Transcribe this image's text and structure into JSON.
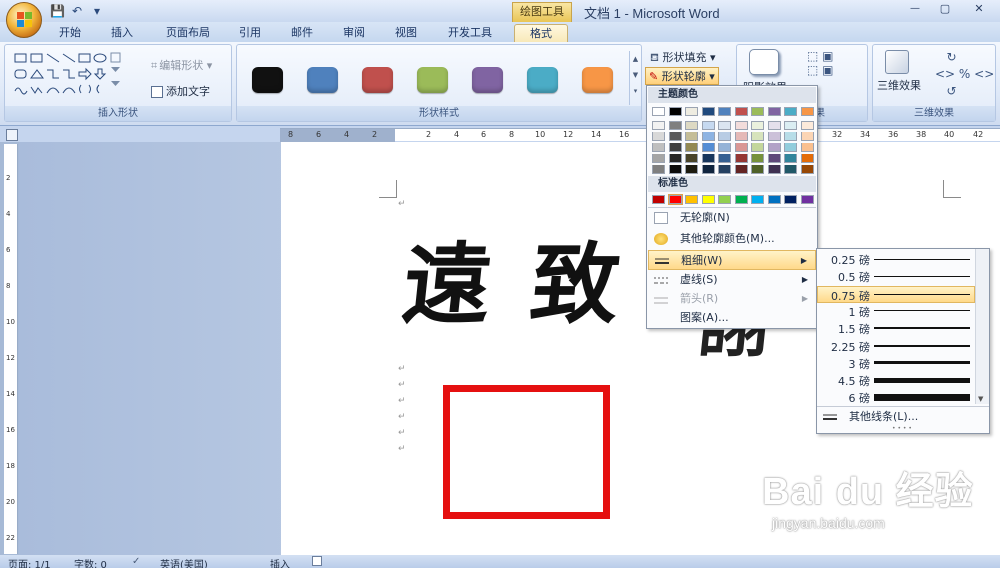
{
  "window": {
    "title": "文档 1 - Microsoft Word",
    "context_tool": "绘图工具",
    "qa_save": "💾",
    "qa_undo": "↶",
    "qa_dropdown": "▾",
    "win_min": "—",
    "win_max": "▢",
    "win_close": "✕"
  },
  "tabs": [
    "开始",
    "插入",
    "页面布局",
    "引用",
    "邮件",
    "审阅",
    "视图",
    "开发工具",
    "格式"
  ],
  "ribbon": {
    "insert_shapes_label": "插入形状",
    "edit_shape": "编辑形状",
    "add_text": "添加文字",
    "shape_styles_label": "形状样式",
    "shape_fill": "形状填充",
    "shape_outline": "形状轮廓",
    "shadow_effects": "阴影效果",
    "three_d_effects": "三维效果",
    "three_d_effects_label": "三维效果",
    "shadow_group_tail": "果",
    "style_swatches": [
      "#111111",
      "#4f81bd",
      "#c0504d",
      "#9bbb59",
      "#8064a2",
      "#4bacc6",
      "#f79646"
    ]
  },
  "ruler_ticks": [
    "8",
    "6",
    "4",
    "2",
    "2",
    "4",
    "6",
    "8",
    "10",
    "12",
    "14",
    "16",
    "32",
    "34",
    "36",
    "38",
    "40",
    "42"
  ],
  "vruler_ticks": [
    "2",
    "4",
    "6",
    "8",
    "10",
    "12",
    "14",
    "16",
    "18",
    "20",
    "22"
  ],
  "document": {
    "calligraphy_text": "遠致",
    "calligraphy_tail": "詡",
    "para_mark": "↵"
  },
  "status": {
    "page": "页面: 1/1",
    "words": "字数: 0",
    "language": "英语(美国)",
    "insert": "插入"
  },
  "menu": {
    "theme_colors_label": "主题颜色",
    "standard_colors_label": "标准色",
    "theme_top_row": [
      "#ffffff",
      "#000000",
      "#eeece1",
      "#1f497d",
      "#4f81bd",
      "#c0504d",
      "#9bbb59",
      "#8064a2",
      "#4bacc6",
      "#f79646"
    ],
    "theme_columns": [
      [
        "#f2f2f2",
        "#d8d8d8",
        "#bfbfbf",
        "#a5a5a5",
        "#7f7f7f"
      ],
      [
        "#7f7f7f",
        "#595959",
        "#3f3f3f",
        "#262626",
        "#0c0c0c"
      ],
      [
        "#ddd9c3",
        "#c4bd97",
        "#938953",
        "#494429",
        "#1d1b10"
      ],
      [
        "#c6d9f0",
        "#8db3e2",
        "#548dd4",
        "#17365d",
        "#0f243e"
      ],
      [
        "#dbe5f1",
        "#b8cce4",
        "#95b3d7",
        "#366092",
        "#244061"
      ],
      [
        "#f2dcdb",
        "#e5b9b7",
        "#d99694",
        "#953734",
        "#632423"
      ],
      [
        "#ebf1dd",
        "#d7e3bc",
        "#c3d69b",
        "#76923c",
        "#4f6128"
      ],
      [
        "#e5e0ec",
        "#ccc1d9",
        "#b2a2c7",
        "#5f497a",
        "#3f3151"
      ],
      [
        "#dbeef3",
        "#b7dde8",
        "#92cddc",
        "#31859b",
        "#205867"
      ],
      [
        "#fdeada",
        "#fbd5b5",
        "#fac08f",
        "#e36c09",
        "#974806"
      ]
    ],
    "standard_colors": [
      "#c00000",
      "#ff0000",
      "#ffc000",
      "#ffff00",
      "#92d050",
      "#00b050",
      "#00b0f0",
      "#0070c0",
      "#002060",
      "#7030a0"
    ],
    "no_outline": "无轮廓(N)",
    "more_colors": "其他轮廓颜色(M)...",
    "weight": "粗细(W)",
    "dashes": "虚线(S)",
    "arrows": "箭头(R)",
    "pattern": "图案(A)...",
    "submenu_arrow": "▶"
  },
  "weights": [
    {
      "label": "0.25 磅",
      "pt": 0.25
    },
    {
      "label": "0.5 磅",
      "pt": 0.5
    },
    {
      "label": "0.75 磅",
      "pt": 0.75
    },
    {
      "label": "1 磅",
      "pt": 1
    },
    {
      "label": "1.5 磅",
      "pt": 1.5
    },
    {
      "label": "2.25 磅",
      "pt": 2.25
    },
    {
      "label": "3 磅",
      "pt": 3
    },
    {
      "label": "4.5 磅",
      "pt": 4.5
    },
    {
      "label": "6 磅",
      "pt": 6
    }
  ],
  "more_lines": "其他线条(L)...",
  "submenu_grip": "• • • •",
  "watermark": {
    "brand": "Bai du 经验",
    "url": "jingyan.baidu.com"
  }
}
